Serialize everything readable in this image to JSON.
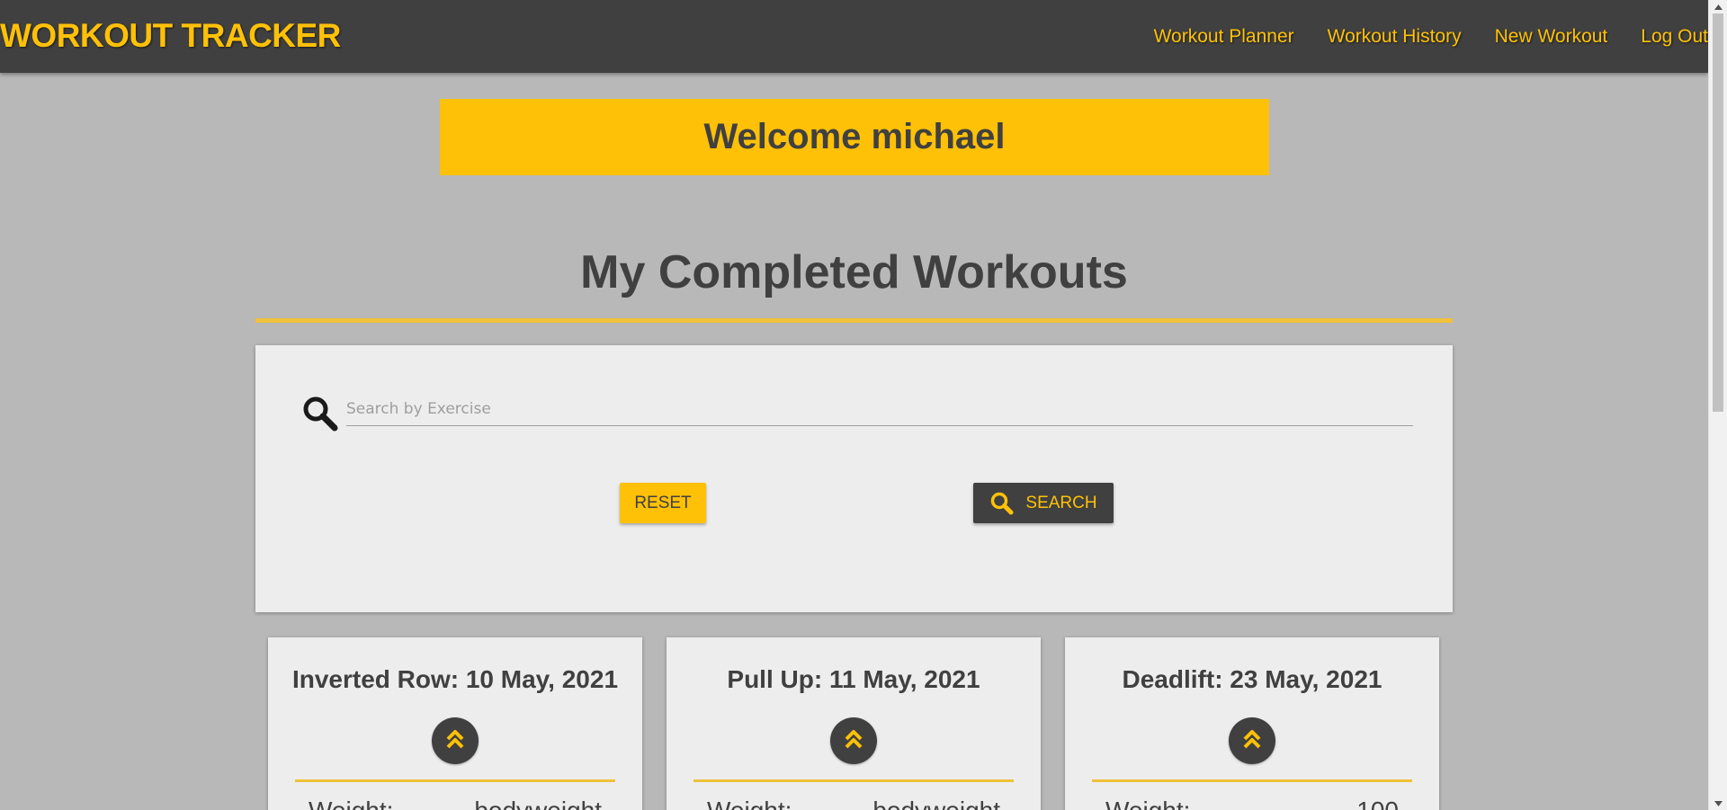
{
  "navbar": {
    "brand": "WORKOUT TRACKER",
    "links": [
      "Workout Planner",
      "Workout History",
      "New Workout",
      "Log Out"
    ]
  },
  "welcome": "Welcome michael",
  "page_title": "My Completed Workouts",
  "search": {
    "placeholder": "Search by Exercise",
    "value": "",
    "reset_label": "RESET",
    "search_label": "SEARCH"
  },
  "cards": [
    {
      "title": "Inverted Row: 10 May, 2021",
      "row_label": "Weight:",
      "row_value": "bodyweight"
    },
    {
      "title": "Pull Up: 11 May, 2021",
      "row_label": "Weight:",
      "row_value": "bodyweight"
    },
    {
      "title": "Deadlift: 23 May, 2021",
      "row_label": "Weight:",
      "row_value": "100"
    }
  ],
  "colors": {
    "accent": "#ffc107",
    "dark": "#404040",
    "page_bg": "#b8b8b8",
    "panel_bg": "#ededed"
  },
  "icons": {
    "search": "search-icon",
    "expand": "double-chevron-up-icon"
  }
}
